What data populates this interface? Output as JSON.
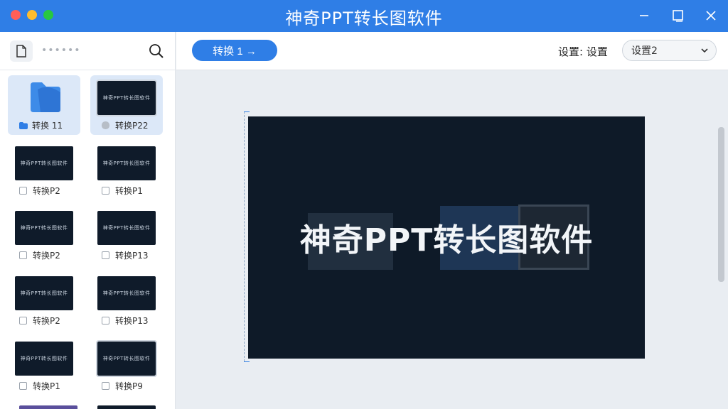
{
  "window": {
    "title": "神奇PPT转长图软件"
  },
  "sidebar": {
    "header_dots": "••••••",
    "items": [
      {
        "label": "转换 11",
        "kind": "folder",
        "selected": true
      },
      {
        "label": "转换P22",
        "kind": "slide",
        "selected": true,
        "thumb_text": "神奇PPT转长图软件"
      },
      {
        "label": "转换P2",
        "kind": "slide",
        "selected": false,
        "thumb_text": "神奇PPT转长图软件"
      },
      {
        "label": "转换P1",
        "kind": "slide",
        "selected": false,
        "thumb_text": "神奇PPT转长图软件"
      },
      {
        "label": "转换P2",
        "kind": "slide",
        "selected": false,
        "thumb_text": "神奇PPT转长图软件"
      },
      {
        "label": "转换P13",
        "kind": "slide",
        "selected": false,
        "thumb_text": "神奇PPT转长图软件"
      },
      {
        "label": "转换P2",
        "kind": "slide",
        "selected": false,
        "thumb_text": "神奇PPT转长图软件"
      },
      {
        "label": "转换P13",
        "kind": "slide",
        "selected": false,
        "thumb_text": "神奇PPT转长图软件"
      },
      {
        "label": "转换P1",
        "kind": "slide",
        "selected": false,
        "thumb_text": "神奇PPT转长图软件"
      },
      {
        "label": "转换P9",
        "kind": "slide",
        "selected": false,
        "thumb_text": "神奇PPT转长图软件"
      }
    ]
  },
  "toolbar": {
    "convert_label": "转换 1 →",
    "settings_label": "设置: 设置",
    "select_value": "设置2"
  },
  "preview": {
    "title": "神奇PPT转长图软件"
  },
  "colors": {
    "accent": "#2f7ee6",
    "slide_bg": "#0e1a28"
  }
}
